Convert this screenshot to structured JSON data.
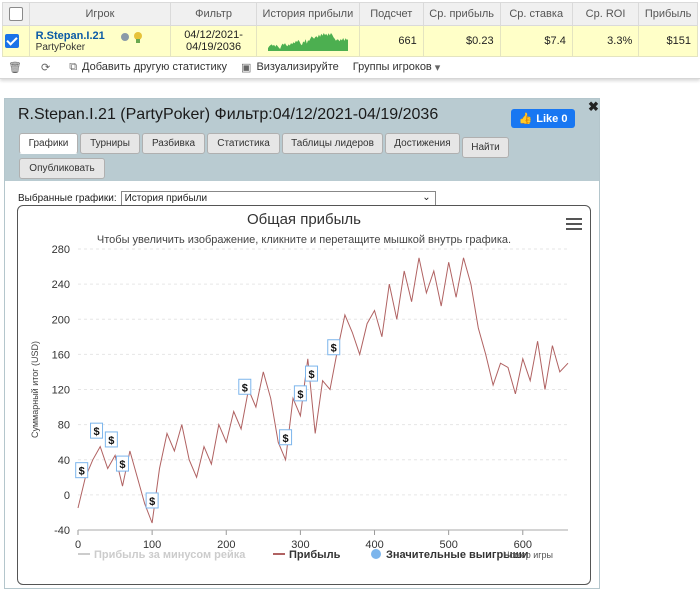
{
  "grid": {
    "headers": [
      "Игрок",
      "Фильтр",
      "История прибыли",
      "Подсчет",
      "Ср. прибыль",
      "Ср. ставка",
      "Ср. ROI",
      "Прибыль"
    ],
    "row": {
      "player_name": "R.Stepan.I.21",
      "site": "PartyPoker",
      "filter_line1": "04/12/2021-",
      "filter_line2": "04/19/2036",
      "count": "661",
      "avg_profit": "$0.23",
      "avg_stake": "$7.4",
      "avg_roi": "3.3%",
      "profit": "$151"
    }
  },
  "toolbar": {
    "add_stats": "Добавить другую статистику",
    "visualize": "Визуализируйте",
    "player_groups": "Группы игроков"
  },
  "dialog": {
    "title": "R.Stepan.I.21 (PartyPoker) Фильтр:04/12/2021-04/19/2036",
    "like_label": "Like 0",
    "tabs": [
      "Графики",
      "Турниры",
      "Разбивка",
      "Статистика",
      "Таблицы лидеров",
      "Достижения",
      "Найти",
      "Опубликовать"
    ],
    "selected_charts_label": "Выбранные графики:",
    "selected_chart_value": "История прибыли"
  },
  "chart_data": {
    "type": "line",
    "title": "Общая прибыль",
    "subtitle": "Чтобы увеличить изображение, кликните и перетащите мышкой внутрь графика.",
    "ylabel": "Суммарный итог (USD)",
    "xlabel": "Номер игры",
    "ylim": [
      -40,
      280
    ],
    "xlim": [
      0,
      661
    ],
    "yticks": [
      -40,
      0,
      40,
      80,
      120,
      160,
      200,
      240,
      280
    ],
    "xticks": [
      0,
      100,
      200,
      300,
      400,
      500,
      600
    ],
    "grid": true,
    "legend": [
      {
        "name": "Прибыль за минусом рейка",
        "color": "#cccccc"
      },
      {
        "name": "Прибыль",
        "color": "#b06262"
      },
      {
        "name": "Значительные выигрыши",
        "color": "#7cb5ec"
      }
    ],
    "series": [
      {
        "name": "Прибыль",
        "color": "#b06262",
        "x": [
          0,
          10,
          20,
          30,
          40,
          50,
          60,
          70,
          80,
          90,
          100,
          110,
          120,
          130,
          140,
          150,
          160,
          170,
          180,
          190,
          200,
          210,
          220,
          230,
          240,
          250,
          260,
          270,
          280,
          290,
          300,
          310,
          320,
          330,
          340,
          350,
          360,
          370,
          380,
          390,
          400,
          410,
          420,
          430,
          440,
          450,
          460,
          470,
          480,
          490,
          500,
          510,
          520,
          530,
          540,
          550,
          560,
          570,
          580,
          590,
          600,
          610,
          620,
          630,
          640,
          650,
          661
        ],
        "values": [
          -15,
          20,
          40,
          55,
          30,
          45,
          10,
          50,
          20,
          -10,
          -32,
          30,
          70,
          50,
          80,
          40,
          20,
          55,
          35,
          80,
          60,
          95,
          75,
          120,
          100,
          140,
          110,
          60,
          40,
          110,
          90,
          155,
          70,
          130,
          120,
          165,
          205,
          185,
          160,
          195,
          210,
          180,
          240,
          200,
          255,
          220,
          270,
          230,
          255,
          215,
          265,
          225,
          270,
          240,
          190,
          160,
          125,
          150,
          145,
          115,
          155,
          130,
          175,
          120,
          170,
          140,
          150
        ]
      }
    ],
    "markers": [
      {
        "x": 5,
        "label": "$"
      },
      {
        "x": 25,
        "label": "$"
      },
      {
        "x": 45,
        "label": "$"
      },
      {
        "x": 60,
        "label": "$"
      },
      {
        "x": 100,
        "label": "$"
      },
      {
        "x": 225,
        "label": "$"
      },
      {
        "x": 280,
        "label": "$"
      },
      {
        "x": 300,
        "label": "$"
      },
      {
        "x": 315,
        "label": "$"
      },
      {
        "x": 345,
        "label": "$"
      }
    ]
  }
}
